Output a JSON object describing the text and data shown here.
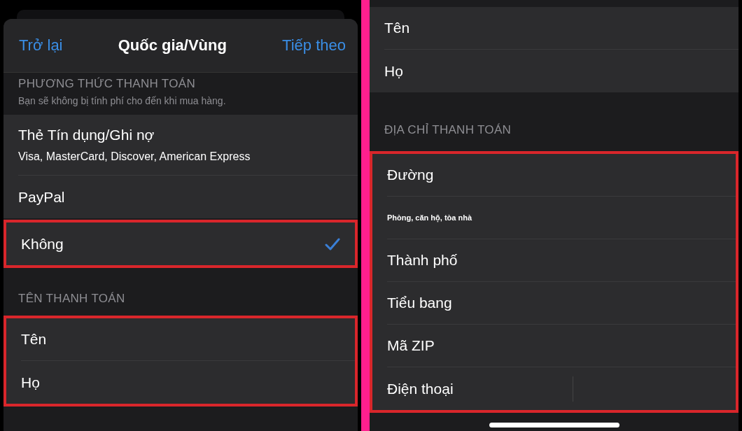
{
  "left_screen": {
    "nav": {
      "back": "Trở lại",
      "title": "Quốc gia/Vùng",
      "next": "Tiếp theo"
    },
    "sections": [
      {
        "kind": "header",
        "title": "PHƯƠNG THỨC THANH TOÁN",
        "subtitle": "Bạn sẽ không bị tính phí cho đến khi mua hàng."
      },
      {
        "kind": "group",
        "highlighted": false,
        "rows": [
          {
            "kind": "option",
            "label": "Thẻ Tín dụng/Ghi nợ",
            "detail": "Visa, MasterCard, Discover, American Express",
            "selected": false
          },
          {
            "kind": "option",
            "label": "PayPal",
            "selected": false
          }
        ]
      },
      {
        "kind": "group",
        "highlighted": true,
        "rows": [
          {
            "kind": "option",
            "label": "Không",
            "selected": true
          }
        ]
      },
      {
        "kind": "header",
        "title": "TÊN THANH TOÁN"
      },
      {
        "kind": "group",
        "highlighted": true,
        "rows": [
          {
            "kind": "field",
            "label": "Tên"
          },
          {
            "kind": "field",
            "label": "Họ"
          }
        ]
      }
    ]
  },
  "right_screen": {
    "sections": [
      {
        "kind": "group",
        "highlighted": false,
        "rows": [
          {
            "kind": "field",
            "label": "Tên"
          },
          {
            "kind": "field",
            "label": "Họ"
          }
        ]
      },
      {
        "kind": "header",
        "title": "ĐỊA CHỈ THANH TOÁN"
      },
      {
        "kind": "group",
        "highlighted": true,
        "rows": [
          {
            "kind": "field",
            "label": "Đường"
          },
          {
            "kind": "hint",
            "label": "Phòng, căn hộ, tòa nhà"
          },
          {
            "kind": "field",
            "label": "Thành phố"
          },
          {
            "kind": "field",
            "label": "Tiểu bang"
          },
          {
            "kind": "field",
            "label": "Mã ZIP"
          },
          {
            "kind": "phone",
            "label": "Điện thoại"
          }
        ]
      }
    ]
  }
}
